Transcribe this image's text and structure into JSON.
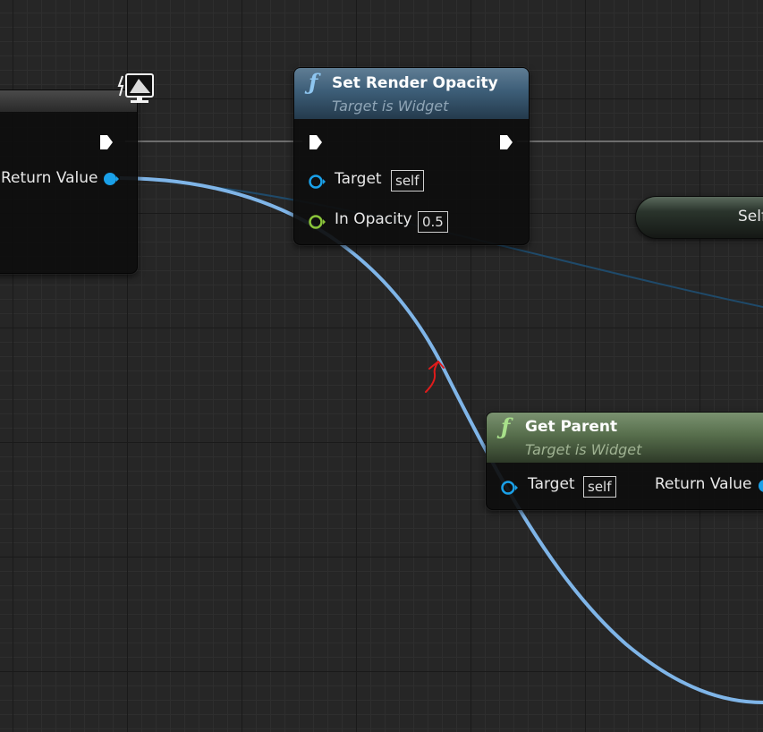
{
  "colors": {
    "wire_object": "#7fb5e8",
    "wire_object_dim": "#1f4a6a",
    "wire_exec": "#6e6e6e",
    "pin_object": "#1aa0e8",
    "pin_float": "#8ac43a",
    "header_function": "#3d5e78",
    "header_pure": "#576e4c"
  },
  "left_node": {
    "return_label": "Return Value",
    "icon": "monitor-network-icon"
  },
  "set_render_opacity": {
    "icon": "function-icon",
    "title": "Set Render Opacity",
    "subtitle": "Target is Widget",
    "target_label": "Target",
    "target_value": "self",
    "opacity_label": "In Opacity",
    "opacity_value": "0.5"
  },
  "self_node": {
    "label": "Self"
  },
  "get_parent": {
    "icon": "function-icon",
    "title": "Get Parent",
    "subtitle": "Target is Widget",
    "target_label": "Target",
    "target_value": "self",
    "return_label": "Return Value"
  },
  "annotation": {
    "icon": "red-arrow-annotation-icon"
  }
}
